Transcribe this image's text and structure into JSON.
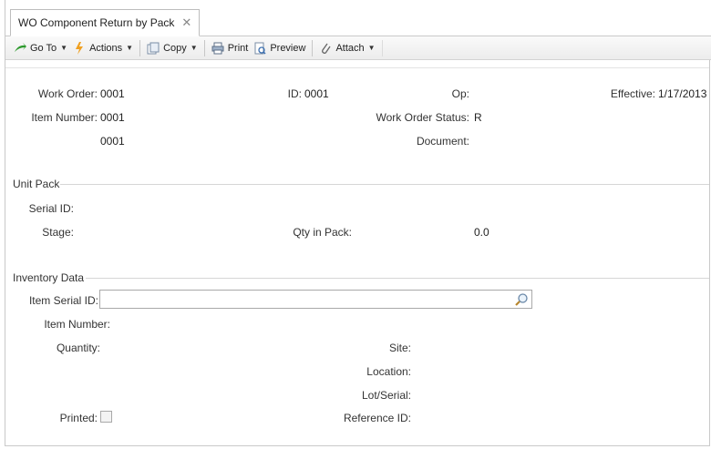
{
  "tab": {
    "title": "WO Component Return by Pack",
    "close": "✕"
  },
  "toolbar": {
    "goto": "Go To",
    "actions": "Actions",
    "copy": "Copy",
    "print": "Print",
    "preview": "Preview",
    "attach": "Attach"
  },
  "header": {
    "work_order_label": "Work Order:",
    "work_order": "0001",
    "id_label": "ID:",
    "id": "0001",
    "op_label": "Op:",
    "effective_label": "Effective:",
    "effective": "1/17/2013",
    "item_number_label": "Item Number:",
    "item_number": "0001",
    "wo_status_label": "Work Order Status:",
    "wo_status": "R",
    "item_desc": "0001",
    "document_label": "Document:"
  },
  "unit_pack": {
    "section": "Unit Pack",
    "serial_id_label": "Serial ID:",
    "stage_label": "Stage:",
    "qty_in_pack_label": "Qty in Pack:",
    "qty_in_pack": "0.0"
  },
  "inventory": {
    "section": "Inventory Data",
    "item_serial_id_label": "Item Serial ID:",
    "item_serial_id_value": "",
    "item_number_label": "Item Number:",
    "quantity_label": "Quantity:",
    "site_label": "Site:",
    "location_label": "Location:",
    "lot_serial_label": "Lot/Serial:",
    "printed_label": "Printed:",
    "reference_id_label": "Reference ID:"
  }
}
